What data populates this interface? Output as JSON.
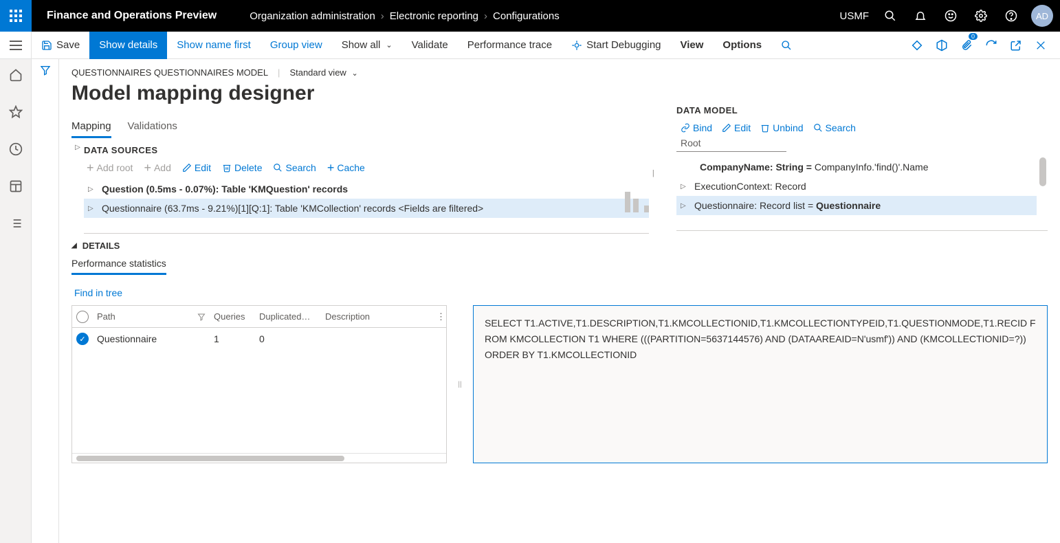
{
  "top": {
    "app_title": "Finance and Operations Preview",
    "breadcrumb": [
      "Organization administration",
      "Electronic reporting",
      "Configurations"
    ],
    "company": "USMF",
    "avatar": "AD"
  },
  "actionbar": {
    "save": "Save",
    "show_details": "Show details",
    "show_name_first": "Show name first",
    "group_view": "Group view",
    "show_all": "Show all",
    "validate": "Validate",
    "perf_trace": "Performance trace",
    "start_debug": "Start Debugging",
    "view": "View",
    "options": "Options"
  },
  "context": {
    "path": "QUESTIONNAIRES QUESTIONNAIRES MODEL",
    "view": "Standard view"
  },
  "page_title": "Model mapping designer",
  "tabs": {
    "mapping": "Mapping",
    "validations": "Validations"
  },
  "ds": {
    "title": "DATA SOURCES",
    "add_root": "Add root",
    "add": "Add",
    "edit": "Edit",
    "delete": "Delete",
    "search": "Search",
    "cache": "Cache",
    "rows": [
      "Question (0.5ms - 0.07%): Table 'KMQuestion' records",
      "Questionnaire (63.7ms - 9.21%)[1][Q:1]: Table 'KMCollection' records <Fields are filtered>"
    ]
  },
  "dm": {
    "title": "DATA MODEL",
    "bind": "Bind",
    "edit": "Edit",
    "unbind": "Unbind",
    "search": "Search",
    "root": "Root",
    "rows": {
      "r1a": "CompanyName: String = ",
      "r1b": "CompanyInfo.'find()'.Name",
      "r2": "ExecutionContext: Record",
      "r3a": "Questionnaire: Record list = ",
      "r3b": "Questionnaire"
    }
  },
  "details": {
    "title": "DETAILS",
    "subtab": "Performance statistics",
    "find": "Find in tree",
    "grid": {
      "h_path": "Path",
      "h_queries": "Queries",
      "h_dup": "Duplicated…",
      "h_desc": "Description",
      "row_path": "Questionnaire",
      "row_q": "1",
      "row_d": "0"
    },
    "sql": "SELECT T1.ACTIVE,T1.DESCRIPTION,T1.KMCOLLECTIONID,T1.KMCOLLECTIONTYPEID,T1.QUESTIONMODE,T1.RECID FROM KMCOLLECTION T1 WHERE (((PARTITION=5637144576) AND (DATAAREAID=N'usmf')) AND (KMCOLLECTIONID=?)) ORDER BY T1.KMCOLLECTIONID"
  }
}
